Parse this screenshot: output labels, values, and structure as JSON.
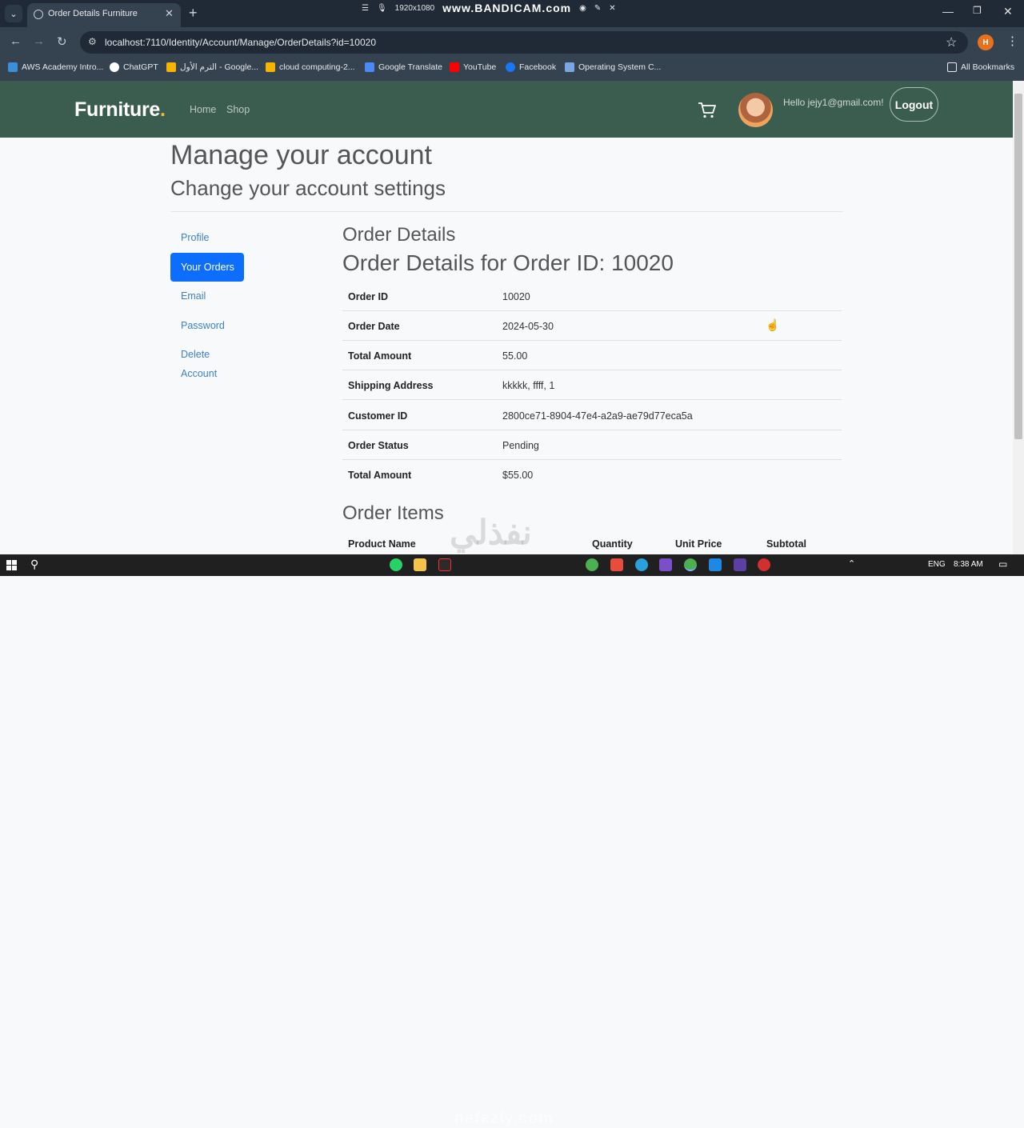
{
  "browser": {
    "tab_title": "Order Details Furniture",
    "url": "localhost:7110/Identity/Account/Manage/OrderDetails?id=10020",
    "profile_initial": "H",
    "recording_resolution": "1920x1080",
    "recording_brand": "www.BANDICAM.com",
    "bookmarks": [
      {
        "label": "AWS Academy Intro...",
        "icon": "cloud-icon",
        "color": "#3b8fd9"
      },
      {
        "label": "ChatGPT",
        "icon": "chatgpt-icon",
        "color": "#ffffff"
      },
      {
        "label": "الترم الأول - Google...",
        "icon": "drive-icon",
        "color": "#f4b400"
      },
      {
        "label": "cloud computing-2...",
        "icon": "drive-icon",
        "color": "#f4b400"
      },
      {
        "label": "Google Translate",
        "icon": "translate-icon",
        "color": "#4a8af4"
      },
      {
        "label": "YouTube",
        "icon": "youtube-icon",
        "color": "#ff0000"
      },
      {
        "label": "Facebook",
        "icon": "facebook-icon",
        "color": "#1877f2"
      },
      {
        "label": "Operating System C...",
        "icon": "doc-icon",
        "color": "#7aa7e0"
      }
    ],
    "all_bookmarks": "All Bookmarks"
  },
  "header": {
    "brand": "Furniture",
    "brand_dot": ".",
    "nav": [
      "Home",
      "Shop"
    ],
    "greeting": "Hello jejy1@gmail.com!",
    "logout": "Logout"
  },
  "page": {
    "title": "Manage your account",
    "subtitle": "Change your account settings",
    "sidebar": [
      "Profile",
      "Your Orders",
      "Email",
      "Password",
      "Delete",
      "Account"
    ],
    "section_title": "Order Details",
    "order_heading": "Order Details for Order ID: 10020",
    "details": [
      {
        "label": "Order ID",
        "value": "10020"
      },
      {
        "label": "Order Date",
        "value": "2024-05-30"
      },
      {
        "label": "Total Amount",
        "value": "55.00"
      },
      {
        "label": "Shipping Address",
        "value": "kkkkk, ffff, 1"
      },
      {
        "label": "Customer ID",
        "value": "2800ce71-8904-47e4-a2a9-ae79d77eca5a"
      },
      {
        "label": "Order Status",
        "value": "Pending"
      },
      {
        "label": "Total Amount",
        "value": "$55.00"
      }
    ],
    "items_title": "Order Items",
    "items_columns": [
      "Product Name",
      "Quantity",
      "Unit Price",
      "Subtotal"
    ]
  },
  "overlay": {
    "watermark_arabic": "نفذلي",
    "watermark_latin": "nafezly.com"
  },
  "taskbar": {
    "lang": "ENG",
    "time": "8:38 AM"
  }
}
